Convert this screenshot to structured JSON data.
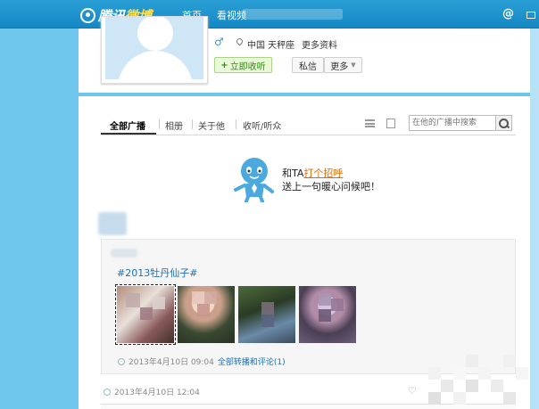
{
  "topbar": {
    "brand_prefix": "腾讯",
    "brand_suffix": "微博",
    "nav": [
      "首页",
      "看视频"
    ]
  },
  "profile": {
    "gender_icon": "male-icon",
    "location": "中国 天秤座",
    "more_info": "更多资料",
    "follow_label": "立即收听",
    "message_label": "私信",
    "more_label": "更多"
  },
  "tabs": [
    "全部广播",
    "相册",
    "关于他",
    "收听/听众"
  ],
  "search": {
    "placeholder": "在他的广播中搜索"
  },
  "greeting": {
    "line1_prefix": "和TA",
    "line1_link": "打个招呼",
    "line2": "送上一句暖心问候吧！"
  },
  "feed": [
    {
      "hashtag": "#2013牡丹仙子#",
      "time": "2013年4月10日 09:04",
      "retweet_link": "全部转播和评论(1)"
    },
    {
      "time": "2013年4月10日 12:04"
    }
  ],
  "colors": {
    "accent": "#1588c4",
    "link": "#1f6fb5",
    "greet_link": "#e66a00",
    "follow_green": "#2f8a16"
  }
}
